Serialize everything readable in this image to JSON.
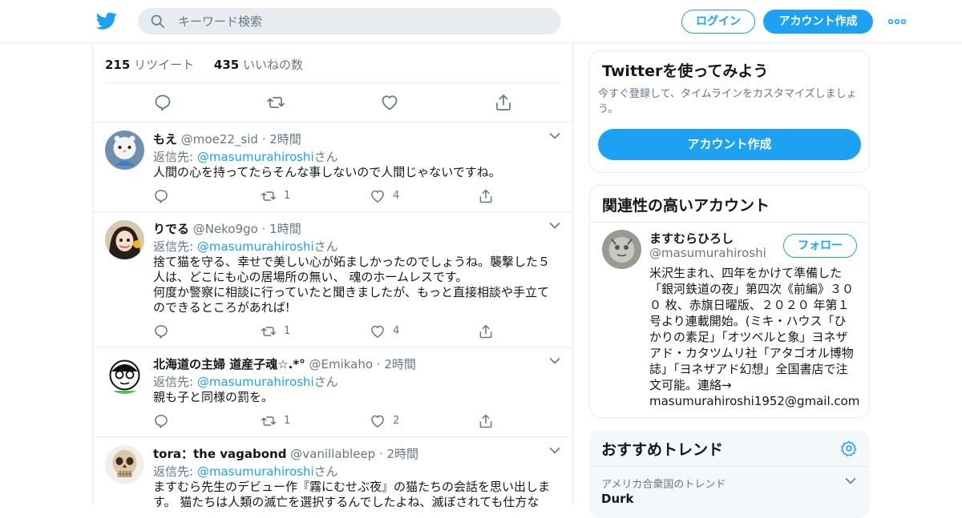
{
  "header": {
    "search_placeholder": "キーワード検索",
    "login_label": "ログイン",
    "signup_label": "アカウント作成",
    "brand_color": "#1da1f2"
  },
  "stats": {
    "retweets_count": "215",
    "retweets_label": "リツイート",
    "likes_count": "435",
    "likes_label": "いいねの数"
  },
  "tweets": [
    {
      "name": "もえ",
      "handle": "@moe22_sid",
      "time": "· 2時間",
      "reply_prefix": "返信先: ",
      "reply_handle": "@masumurahiroshi",
      "reply_suffix": "さん",
      "text_lines": [
        "人間の心を持ってたらそんな事しないので人間じゃないですね。"
      ],
      "retweets": "1",
      "likes": "4"
    },
    {
      "name": "りでる",
      "handle": "@Neko9go",
      "time": "· 1時間",
      "reply_prefix": "返信先: ",
      "reply_handle": "@masumurahiroshi",
      "reply_suffix": "さん",
      "text_lines": [
        "捨て猫を守る、幸せで美しい心が妬ましかったのでしょうね。襲撃した５",
        "人は、どこにも心の居場所の無い、 魂のホームレスです。",
        "何度か警察に相談に行っていたと聞きましたが、もっと直接相談や手立て",
        "のできるところがあれば!"
      ],
      "retweets": "1",
      "likes": "4"
    },
    {
      "name": "北海道の主婦 道産子魂☆.*°",
      "handle": "@Emikaho",
      "time": "· 2時間",
      "reply_prefix": "返信先: ",
      "reply_handle": "@masumurahiroshi",
      "reply_suffix": "さん",
      "text_lines": [
        "親も子と同様の罰を。"
      ],
      "retweets": "1",
      "likes": "2"
    },
    {
      "name": "tora：the vagabond",
      "handle": "@vanillableep",
      "time": "· 2時間",
      "reply_prefix": "返信先: ",
      "reply_handle": "@masumurahiroshi",
      "reply_suffix": "さん",
      "text_lines": [
        "ますむら先生のデビュー作『霧にむせぶ夜』の猫たちの会話を思い出しま",
        "す。 猫たちは人類の滅亡を選択するんでしたよね、滅ぼされても仕方な"
      ],
      "retweets": "",
      "likes": ""
    }
  ],
  "sidebar": {
    "try_twitter": {
      "title": "Twitterを使ってみよう",
      "desc_line1": "今すぐ登録して、タイムラインをカスタマイズしましょ",
      "desc_line2": "う。",
      "button": "アカウント作成"
    },
    "related": {
      "title": "関連性の高いアカウント",
      "name": "ますむらひろし",
      "handle": "@masumurahiroshi",
      "follow": "フォロー",
      "bio_lines": [
        "米沢生まれ、四年をかけて準備した",
        "「銀河鉄道の夜」第四次《前編》３０",
        "０ 枚、赤旗日曜版、２０２０ 年第１",
        "号より連載開始。(ミキ・ハウス「ひ",
        "かりの素足」「オツベルと象」ヨネザ",
        "アド・カタツムリ社「アタゴオル博物",
        "誌」「ヨネザアド幻想」全国書店で注",
        "文可能。連絡→",
        "masumurahiroshi1952@gmail.com"
      ]
    },
    "trends": {
      "title": "おすすめトレンド",
      "location": "アメリカ合衆国のトレンド",
      "first_trend": "Durk"
    }
  }
}
